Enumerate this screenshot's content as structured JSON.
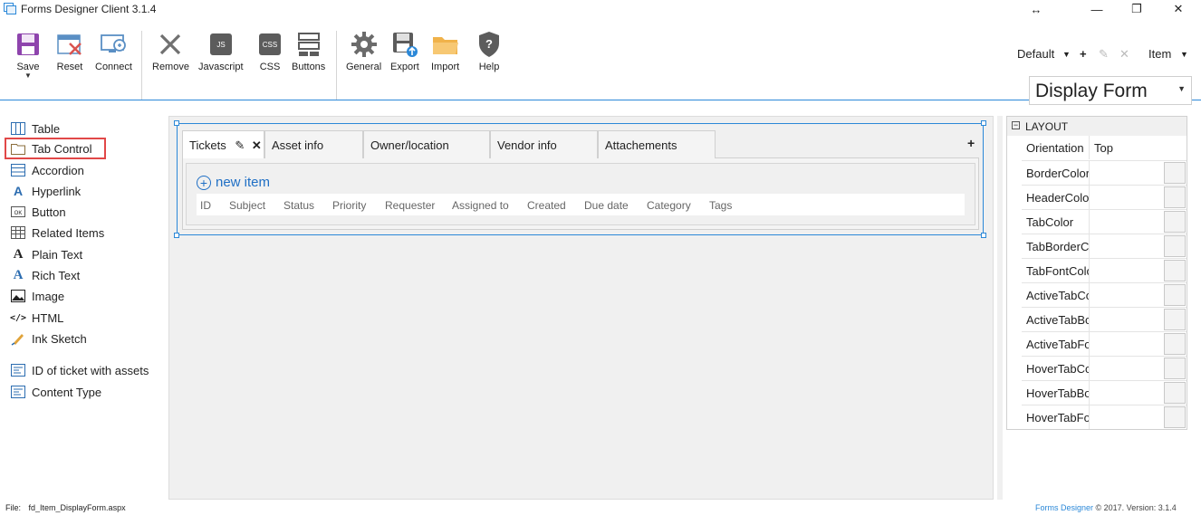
{
  "window": {
    "title": "Forms Designer Client 3.1.4",
    "controls": [
      "↔",
      "—",
      "❐",
      "✕"
    ]
  },
  "ribbon": {
    "buttons": [
      {
        "label": "Save",
        "icon": "save-icon"
      },
      {
        "label": "Reset",
        "icon": "reset-icon"
      },
      {
        "label": "Connect",
        "icon": "connect-icon"
      },
      {
        "label": "Remove",
        "icon": "remove-icon"
      },
      {
        "label": "Javascript",
        "icon": "javascript-icon",
        "badge": "JS"
      },
      {
        "label": "CSS",
        "icon": "css-icon",
        "badge": "CSS"
      },
      {
        "label": "Buttons",
        "icon": "buttons-icon"
      },
      {
        "label": "General",
        "icon": "gear-icon"
      },
      {
        "label": "Export",
        "icon": "export-icon"
      },
      {
        "label": "Import",
        "icon": "folder-icon"
      },
      {
        "label": "Help",
        "icon": "shield-help-icon",
        "badge": "?"
      }
    ]
  },
  "top_right": {
    "set_label": "Default",
    "add": "+",
    "edit": "✎",
    "delete": "✕",
    "content_type": "Item",
    "form_type": "Display Form"
  },
  "toolbox": {
    "items": [
      {
        "label": "Table",
        "icon": "table-icon"
      },
      {
        "label": "Tab Control",
        "icon": "tab-control-icon",
        "selected": true
      },
      {
        "label": "Accordion",
        "icon": "accordion-icon"
      },
      {
        "label": "Hyperlink",
        "icon": "hyperlink-icon"
      },
      {
        "label": "Button",
        "icon": "button-icon"
      },
      {
        "label": "Related Items",
        "icon": "related-items-icon"
      },
      {
        "label": "Plain Text",
        "icon": "plain-text-icon"
      },
      {
        "label": "Rich Text",
        "icon": "rich-text-icon"
      },
      {
        "label": "Image",
        "icon": "image-icon"
      },
      {
        "label": "HTML",
        "icon": "html-icon"
      },
      {
        "label": "Ink Sketch",
        "icon": "ink-sketch-icon"
      },
      {
        "label": "ID of ticket with assets",
        "icon": "field-icon"
      },
      {
        "label": "Content Type",
        "icon": "field-icon"
      }
    ]
  },
  "tabs": [
    {
      "label": "Tickets",
      "active": true
    },
    {
      "label": "Asset info"
    },
    {
      "label": "Owner/location"
    },
    {
      "label": "Vendor info"
    },
    {
      "label": "Attachements"
    }
  ],
  "tab_add": "+",
  "related": {
    "new_item": "new item",
    "columns": [
      "ID",
      "Subject",
      "Status",
      "Priority",
      "Requester",
      "Assigned to",
      "Created",
      "Due date",
      "Category",
      "Tags"
    ]
  },
  "properties": {
    "section": "LAYOUT",
    "rows": [
      {
        "name": "Orientation",
        "value": "Top"
      },
      {
        "name": "BorderColor",
        "value": ""
      },
      {
        "name": "HeaderColor",
        "value": ""
      },
      {
        "name": "TabColor",
        "value": ""
      },
      {
        "name": "TabBorderColor",
        "value": ""
      },
      {
        "name": "TabFontColor",
        "value": ""
      },
      {
        "name": "ActiveTabColor",
        "value": ""
      },
      {
        "name": "ActiveTabBorderColor",
        "value": ""
      },
      {
        "name": "ActiveTabFontColor",
        "value": ""
      },
      {
        "name": "HoverTabColor",
        "value": ""
      },
      {
        "name": "HoverTabBorderColor",
        "value": ""
      },
      {
        "name": "HoverTabFontColor",
        "value": ""
      }
    ]
  },
  "status": {
    "file_label": "File:",
    "file_name": "fd_Item_DisplayForm.aspx",
    "brand": "Forms Designer",
    "copyright": "© 2017. Version: 3.1.4"
  },
  "colors": {
    "accent": "#2b88d8",
    "selection_outline": "#e14848",
    "link": "#1f6fc5"
  }
}
